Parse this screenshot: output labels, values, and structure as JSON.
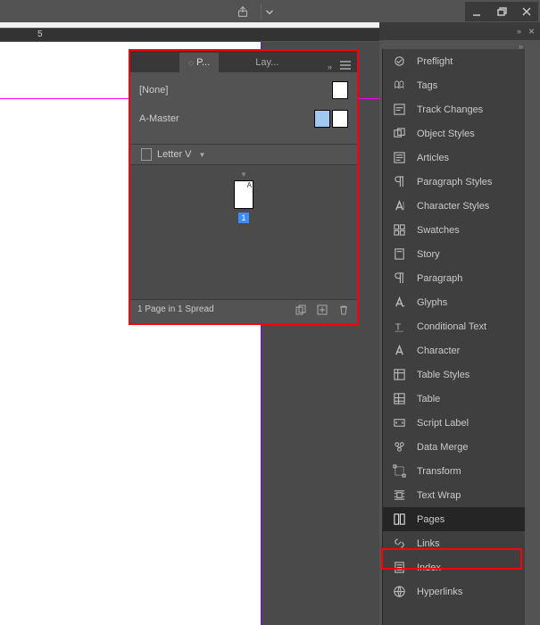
{
  "menubar": {
    "share_icon": "share-icon",
    "dropdown_icon": "chevron-down-icon"
  },
  "window_controls": {
    "minimize": "minimize-icon",
    "restore": "restore-icon",
    "close": "close-icon"
  },
  "ruler": {
    "tick5": "5"
  },
  "panel_controls": {
    "expand_chev": "»",
    "close_x": "×"
  },
  "tool_panel": {
    "items": [
      {
        "icon": "preflight-icon",
        "label": "Preflight",
        "selected": false
      },
      {
        "icon": "tags-icon",
        "label": "Tags",
        "selected": false
      },
      {
        "icon": "track-changes-icon",
        "label": "Track Changes",
        "selected": false
      },
      {
        "icon": "object-styles-icon",
        "label": "Object Styles",
        "selected": false
      },
      {
        "icon": "articles-icon",
        "label": "Articles",
        "selected": false
      },
      {
        "icon": "paragraph-styles-icon",
        "label": "Paragraph Styles",
        "selected": false
      },
      {
        "icon": "character-styles-icon",
        "label": "Character Styles",
        "selected": false
      },
      {
        "icon": "swatches-icon",
        "label": "Swatches",
        "selected": false
      },
      {
        "icon": "story-icon",
        "label": "Story",
        "selected": false
      },
      {
        "icon": "paragraph-icon",
        "label": "Paragraph",
        "selected": false
      },
      {
        "icon": "glyphs-icon",
        "label": "Glyphs",
        "selected": false
      },
      {
        "icon": "conditional-text-icon",
        "label": "Conditional Text",
        "selected": false
      },
      {
        "icon": "character-icon",
        "label": "Character",
        "selected": false
      },
      {
        "icon": "table-styles-icon",
        "label": "Table Styles",
        "selected": false
      },
      {
        "icon": "table-icon",
        "label": "Table",
        "selected": false
      },
      {
        "icon": "script-label-icon",
        "label": "Script Label",
        "selected": false
      },
      {
        "icon": "data-merge-icon",
        "label": "Data Merge",
        "selected": false
      },
      {
        "icon": "transform-icon",
        "label": "Transform",
        "selected": false
      },
      {
        "icon": "text-wrap-icon",
        "label": "Text Wrap",
        "selected": false
      },
      {
        "icon": "pages-icon",
        "label": "Pages",
        "selected": true
      },
      {
        "icon": "links-icon",
        "label": "Links",
        "selected": false
      },
      {
        "icon": "index-icon",
        "label": "Index",
        "selected": false
      },
      {
        "icon": "hyperlinks-icon",
        "label": "Hyperlinks",
        "selected": false
      }
    ]
  },
  "pages_panel": {
    "tabs": {
      "pages_short": "P...",
      "layers_short": "Lay...",
      "chev": "»"
    },
    "masters": [
      {
        "label": "[None]"
      },
      {
        "label": "A-Master"
      }
    ],
    "preset": {
      "label": "Letter V"
    },
    "page_letter": "A",
    "page_number": "1",
    "status_text": "1 Page in 1 Spread"
  }
}
